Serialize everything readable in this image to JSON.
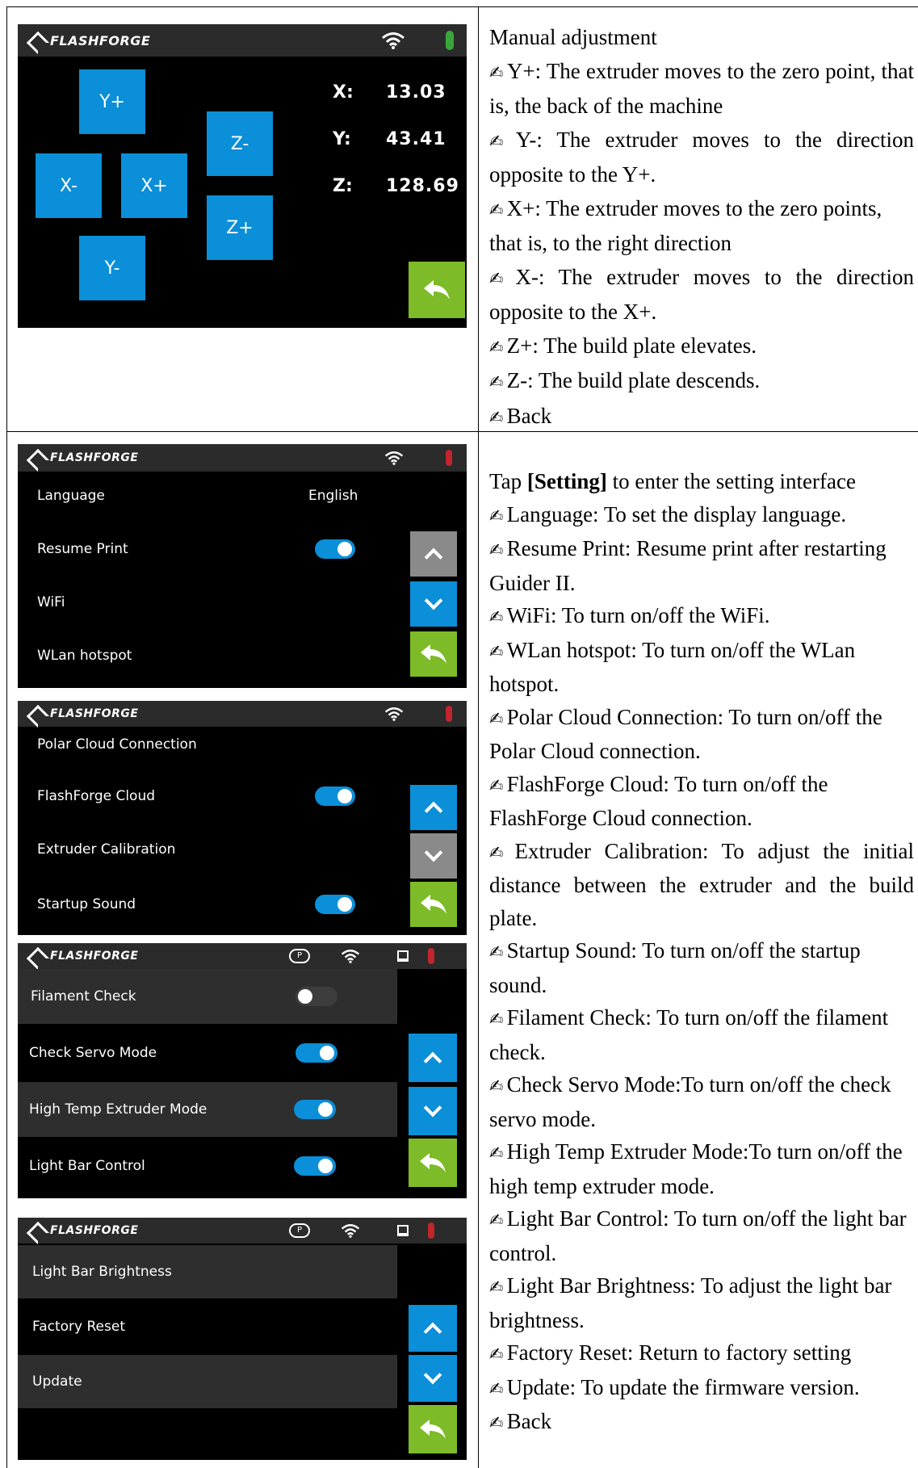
{
  "brand": "FLASHFORGE",
  "colors": {
    "accent_blue": "#0a8fd8",
    "back_green": "#7dbb28",
    "disabled_gray": "#8a8a8a",
    "thermo_green": "#3aa63a",
    "thermo_red": "#c0262c"
  },
  "manual": {
    "buttons": {
      "y_plus": "Y+",
      "y_minus": "Y-",
      "x_minus": "X-",
      "x_plus": "X+",
      "z_minus": "Z-",
      "z_plus": "Z+"
    },
    "coords": [
      {
        "label": "X:",
        "value": "13.03"
      },
      {
        "label": "Y:",
        "value": "43.41"
      },
      {
        "label": "Z:",
        "value": "128.69"
      }
    ]
  },
  "settings1": {
    "rows": [
      {
        "label": "Language",
        "value": "English"
      },
      {
        "label": "Resume Print"
      },
      {
        "label": "WiFi"
      },
      {
        "label": "WLan hotspot"
      }
    ]
  },
  "settings2": {
    "rows": [
      {
        "label": "Polar Cloud Connection"
      },
      {
        "label": "FlashForge Cloud"
      },
      {
        "label": "Extruder Calibration"
      },
      {
        "label": "Startup Sound"
      }
    ]
  },
  "settings3": {
    "cloud_icon_letter": "P",
    "rows": [
      {
        "label": "Filament Check"
      },
      {
        "label": "Check Servo Mode"
      },
      {
        "label": "High Temp Extruder Mode"
      },
      {
        "label": "Light Bar Control"
      }
    ]
  },
  "settings4": {
    "cloud_icon_letter": "P",
    "rows": [
      {
        "label": "Light Bar Brightness"
      },
      {
        "label": "Factory Reset"
      },
      {
        "label": "Update"
      }
    ]
  },
  "desc1": {
    "title": "Manual adjustment",
    "items": [
      "Y+: The extruder moves to the zero point, that is, the back of the machine",
      "Y-: The extruder moves to the direction opposite to the Y+.",
      "X+: The extruder moves to the zero points, that is, to the right direction",
      "X-: The extruder moves to the direction opposite to the X+.",
      "Z+: The build plate elevates.",
      "Z-: The build plate descends.",
      "Back"
    ]
  },
  "desc2": {
    "intro_before": "Tap ",
    "intro_bold": "[Setting]",
    "intro_after": " to enter the setting interface",
    "items": [
      "Language: To set the display language.",
      "Resume Print: Resume print after restarting Guider II.",
      "WiFi: To turn on/off the WiFi.",
      "WLan hotspot: To turn on/off the WLan hotspot.",
      "Polar Cloud Connection: To turn on/off the Polar Cloud connection.",
      "FlashForge Cloud: To turn on/off the FlashForge Cloud connection.",
      "Extruder Calibration: To adjust the initial distance between the extruder and the build plate.",
      "Startup Sound: To turn on/off the startup sound.",
      "Filament Check: To turn on/off the filament check.",
      "Check Servo Mode:To turn on/off the check servo mode.",
      "High Temp Extruder Mode:To turn on/off the high temp extruder mode.",
      "Light Bar Control: To turn on/off the light bar control.",
      "Light Bar Brightness: To adjust the light bar brightness.",
      "Factory Reset: Return to factory setting",
      "Update: To update the firmware version.",
      "Back"
    ]
  }
}
